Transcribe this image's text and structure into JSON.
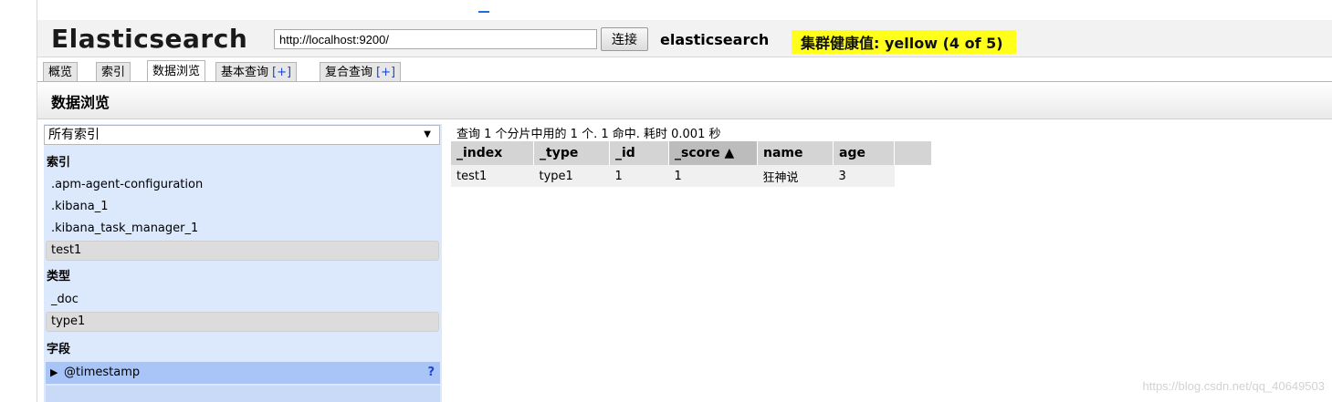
{
  "header": {
    "app_title": "Elasticsearch",
    "url_value": "http://localhost:9200/",
    "connect_label": "连接",
    "cluster_name": "elasticsearch",
    "health_text": "集群健康值: yellow (4 of 5)",
    "health_color": "#ffff1a"
  },
  "tabs": [
    {
      "label": "概览",
      "plus": ""
    },
    {
      "label": "索引",
      "plus": ""
    },
    {
      "label": "数据浏览",
      "plus": "",
      "active": true
    },
    {
      "label": "基本查询",
      "plus": "[+]"
    },
    {
      "label": "复合查询",
      "plus": "[+]"
    }
  ],
  "section_title": "数据浏览",
  "sidebar": {
    "index_select_value": "所有索引",
    "index_group_label": "索引",
    "indices": [
      ".apm-agent-configuration",
      ".kibana_1",
      ".kibana_task_manager_1",
      "test1"
    ],
    "type_group_label": "类型",
    "types": [
      "_doc",
      "type1"
    ],
    "field_group_label": "字段",
    "fields": [
      {
        "name": "@timestamp",
        "help": "?"
      }
    ]
  },
  "results": {
    "summary": "查询 1 个分片中用的 1 个. 1 命中. 耗时 0.001 秒",
    "columns": [
      "_index",
      "_type",
      "_id",
      "_score ▲",
      "name",
      "age"
    ],
    "rows": [
      [
        "test1",
        "type1",
        "1",
        "1",
        "狂神说",
        "3"
      ]
    ]
  },
  "watermark": "https://blog.csdn.net/qq_40649503",
  "colors": {
    "accent_blue": "#1e46d2",
    "sidebar_bg": "#dce8fb",
    "selected_field_bg": "#a9c4f6"
  }
}
